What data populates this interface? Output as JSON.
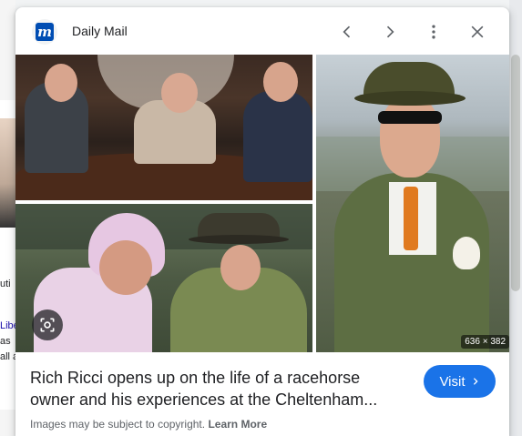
{
  "background": {
    "snippets": [
      "uti",
      "Libe",
      "as",
      "all a"
    ]
  },
  "panel": {
    "source": {
      "name": "Daily Mail",
      "favicon_letter": "m"
    },
    "header_icons": [
      "chevron-left-icon",
      "chevron-right-icon",
      "more-vert-icon",
      "close-icon"
    ],
    "images": {
      "dimensions": "636 × 382"
    },
    "title": "Rich Ricci opens up on the life of a racehorse owner and his experiences at the Cheltenham...",
    "visit_label": "Visit",
    "copyright_text": "Images may be subject to copyright.",
    "learn_more": "Learn More"
  },
  "colors": {
    "accent": "#1a73e8",
    "brand": "#004db3",
    "text": "#202124",
    "muted": "#5f6368"
  }
}
